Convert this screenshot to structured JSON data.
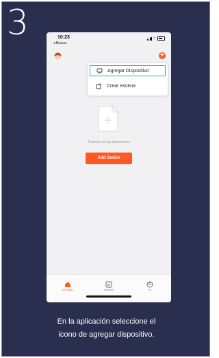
{
  "step": {
    "number": "3"
  },
  "status_bar": {
    "time": "10:23",
    "back_label": "◂ Buscar"
  },
  "header": {
    "add_icon_glyph": "+"
  },
  "dropdown": {
    "items": [
      {
        "label": "Agregar Dispositivo",
        "icon": "device-plus-icon",
        "highlighted": true
      },
      {
        "label": "Crear escena",
        "icon": "scene-edit-icon",
        "highlighted": false
      }
    ]
  },
  "empty_state": {
    "message": "Todavía no hay dispositivos",
    "button_label": "Add Device"
  },
  "tab_bar": {
    "tabs": [
      {
        "label": "Mi hogar",
        "icon": "home-icon",
        "active": true
      },
      {
        "label": "Escena",
        "icon": "scene-icon",
        "active": false
      },
      {
        "label": "Yo",
        "icon": "user-icon",
        "active": false
      }
    ]
  },
  "caption": {
    "line1": "En la aplicación seleccione el",
    "line2": "icono de agregar dispositivo."
  },
  "colors": {
    "card_background": "#2a2f4f",
    "accent_orange": "#ff5a24",
    "highlight_blue": "#1ea6ee"
  }
}
